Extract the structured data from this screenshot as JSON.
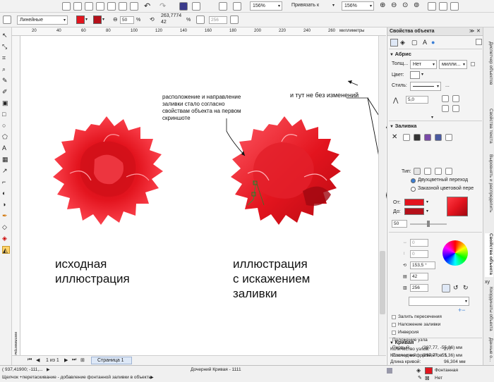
{
  "toolbar_top": {
    "zoom_1": "156%",
    "snap_label": "Привязать к",
    "zoom_2": "156%"
  },
  "toolbar_props": {
    "line_style": "Линейные",
    "fill_percent": "50",
    "percent_sign": "%",
    "size_w": "263,7774",
    "size_h": "42",
    "percent_sign2": "%",
    "dim_field": "256"
  },
  "ruler": {
    "ticks": [
      "20",
      "40",
      "60",
      "80",
      "100",
      "120",
      "140",
      "160",
      "180",
      "200",
      "220",
      "240",
      "260"
    ],
    "unit": "миллиметры",
    "v_unit": "миллиметры"
  },
  "canvas": {
    "annotation_center": "расположение и направление заливки стало согласно свойствам объекта на первом скриншоте",
    "annotation_right": "и тут не без изменений",
    "caption_left_1": "исходная",
    "caption_left_2": "иллюстрация",
    "caption_right_1": "иллюстрация",
    "caption_right_2": "с искажением",
    "caption_right_3": "заливки"
  },
  "pages": {
    "counter": "1 из 1",
    "tab": "Страница 1"
  },
  "panel": {
    "title": "Свойства объекта",
    "outline_header": "Абрис",
    "width_label": "Толщ...",
    "width_value": "Нет",
    "unit_value": "милли...",
    "color_label": "Цвет:",
    "style_label": "Стиль:",
    "ellipsis": "...",
    "miter_value": "5,0",
    "fill_header": "Заливка",
    "type_label": "Тип:",
    "radio_two_color": "Двухцветный переход",
    "radio_custom": "Заказной цветовой пере",
    "from_label": "От:",
    "to_label": "До:",
    "mid_value": "50",
    "val_0a": "0",
    "val_0b": "0",
    "angle_value": "153,5 °",
    "steps_value": "42",
    "padding_value": "256",
    "overprint_fill": "Залить пересечения",
    "overprint_outline": "Наложение заливки",
    "invert": "Инверсия",
    "curve_header": "Кривая",
    "nodes_label": "Количество узлов:",
    "nodes_value": "277",
    "fragments_label": "Количество фрагментов: 1",
    "length_label": "Длина кривой:",
    "length_value": "96,304 мм",
    "node_pos_label": "Положение узла",
    "first_label": "Первый:",
    "first_value": "(397,77, -55,36) мм",
    "last_label": "Последний:",
    "last_value": "(397,77, -55,36) мм"
  },
  "docker_tabs": [
    "Диспетчер объектов",
    "Свойства текста",
    "Выровнять и распределить",
    "Свойства объекта",
    "Координаты объекта",
    "Данные о..."
  ],
  "status": {
    "coords": "( 937,41900; -111,...",
    "object_info": "Дочерний Кривая - 1111",
    "hint": "Щелчок +перетаскивание - добавление фонтанной заливки в объекты",
    "fill_type": "Фонтанная",
    "outline_type": "Нет"
  },
  "colors": {
    "fill_red": "#e3141e",
    "accent_blue": "#3b7fd6"
  }
}
